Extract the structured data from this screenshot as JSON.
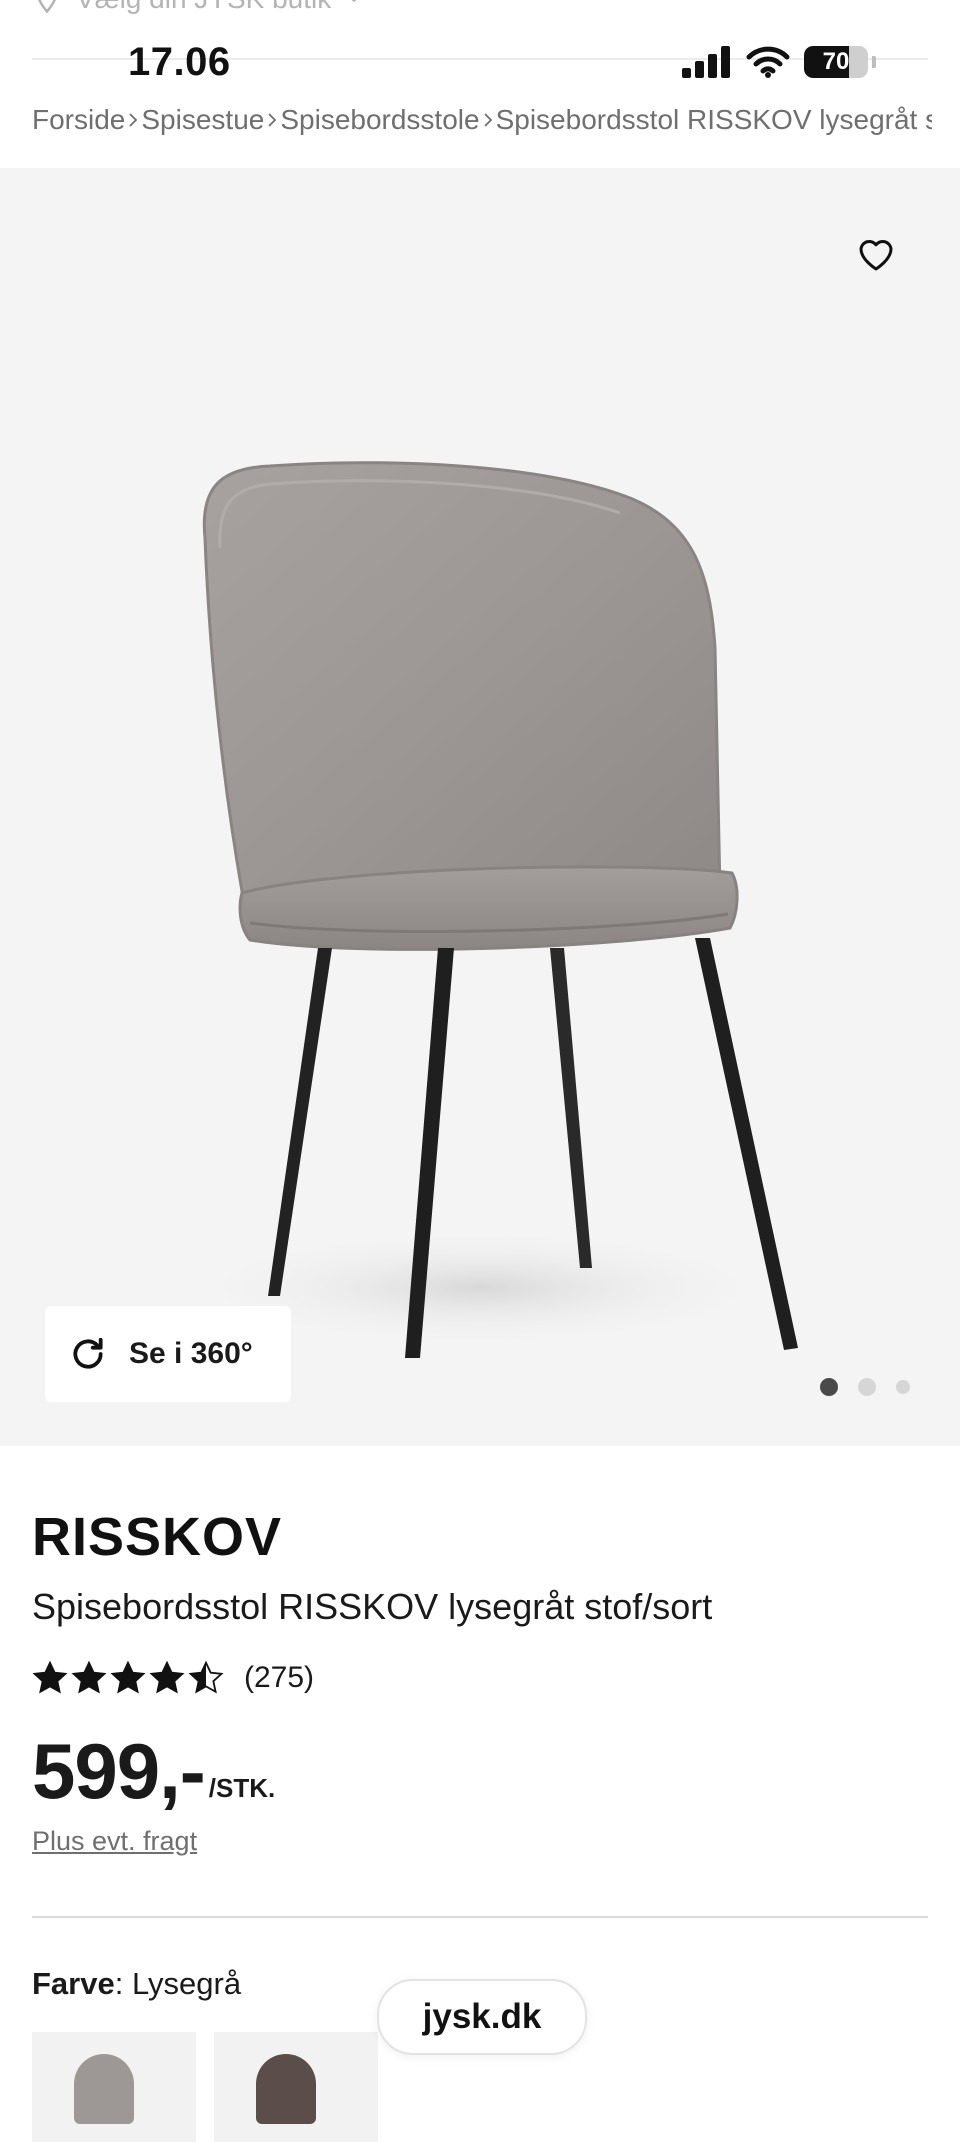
{
  "store_selector": {
    "label": "Vælg din JYSK butik",
    "icon": "location-pin-icon"
  },
  "status_bar": {
    "time": "17.06",
    "battery_level": 70,
    "battery_label": "70"
  },
  "breadcrumb": [
    {
      "label": "Forside"
    },
    {
      "label": "Spisestue"
    },
    {
      "label": "Spisebordsstole"
    },
    {
      "label": "Spisebordsstol RISSKOV lysegråt stof/sort"
    }
  ],
  "gallery": {
    "view360_label": "Se i 360°",
    "dots_total": 3,
    "active_dot": 1
  },
  "product": {
    "brand": "RISSKOV",
    "name": "Spisebordsstol RISSKOV lysegråt stof/sort",
    "rating": 4.5,
    "rating_max": 5,
    "rating_count": "(275)",
    "price": "599,-",
    "price_unit": "/STK.",
    "shipping_note": "Plus evt. fragt",
    "color_label": "Farve",
    "color_value": ": Lysegrå"
  },
  "swatches": [
    {
      "name": "Lysegrå",
      "color": "#9d9795"
    },
    {
      "name": "Mørk",
      "color": "#5a4d4a"
    }
  ],
  "browser": {
    "url": "jysk.dk"
  },
  "colors": {
    "gallery_bg": "#f4f4f4",
    "text": "#1a1a1a",
    "muted": "#6f6f6f"
  }
}
